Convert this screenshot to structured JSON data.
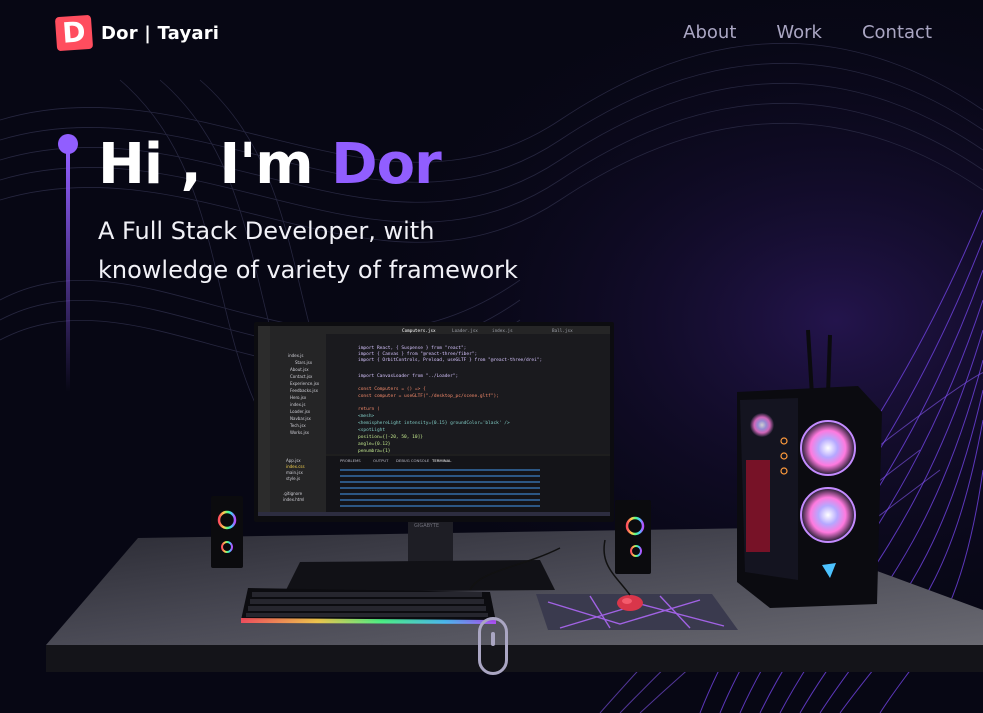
{
  "logo": {
    "mark": "D",
    "text": "Dor | Tayari"
  },
  "nav": {
    "links": [
      "About",
      "Work",
      "Contact"
    ]
  },
  "hero": {
    "greeting": "Hi , I'm",
    "name": "Dor",
    "subtitle_line1": "A Full Stack Developer, with",
    "subtitle_line2": "knowledge of variety of framework"
  },
  "colors": {
    "accent": "#915eff",
    "background": "#070714",
    "nav_text": "#aaa6c3",
    "logo": "#ff4d5e"
  },
  "scene": {
    "monitor_brand": "GIGABYTE",
    "editor_tabs": [
      "Computers.jsx",
      "Loader.jsx",
      "index.js",
      "Ball.jsx"
    ],
    "file_tree": [
      "index.js",
      "Stars.jsx",
      "About.jsx",
      "Contact.jsx",
      "Experience.jsx",
      "Feedbacks.jsx",
      "Hero.jsx",
      "index.js",
      "Loader.jsx",
      "Navbar.jsx",
      "Tech.jsx",
      "Works.jsx",
      "App.jsx",
      "index.css",
      "main.jsx",
      "style.js",
      ".gitignore",
      "index.html"
    ],
    "code_lines": [
      "import React, { Suspense } from \"react\";",
      "import { Canvas } from \"@react-three/fiber\";",
      "import { OrbitControls, Preload, useGLTF } from \"@react-three/drei\";",
      "import CanvasLoader from \"../Loader\";",
      "const Computers = () => {",
      "  const computer = useGLTF(\"./desktop_pc/scene.gltf\");",
      "  return (",
      "    <mesh>",
      "      <hemisphereLight intensity={0.15} groundColor='black' />",
      "      <spotLight",
      "        position={[-20, 50, 10]}",
      "        angle={0.12}",
      "        penumbra={1}"
    ],
    "panel_tabs": [
      "PROBLEMS",
      "OUTPUT",
      "DEBUG CONSOLE",
      "TERMINAL"
    ]
  }
}
